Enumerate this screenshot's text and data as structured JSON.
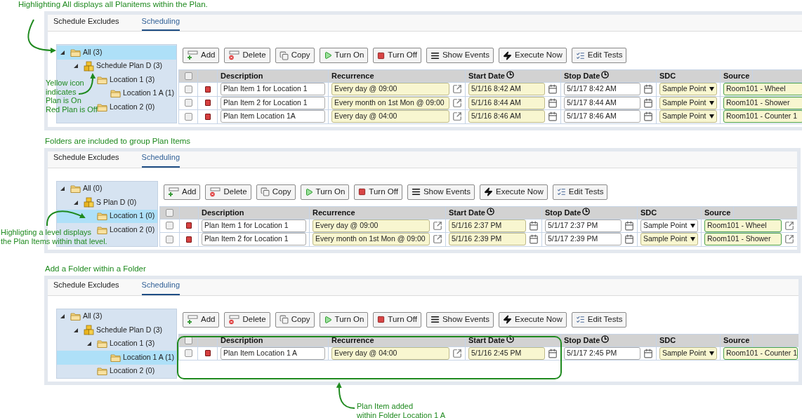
{
  "panels": [
    {
      "caption": "Highlighting All displays all Planitems within the Plan.",
      "tabs": [
        {
          "label": "Schedule Excludes",
          "selected": false
        },
        {
          "label": "Scheduling",
          "selected": true
        }
      ],
      "tree": [
        {
          "label": "All (3)",
          "kind": "folder",
          "expanded": true,
          "selected": true,
          "children": [
            {
              "label": "Schedule Plan D (3)",
              "kind": "plan",
              "expanded": true,
              "selected": false,
              "children": [
                {
                  "label": "Location 1 (3)",
                  "kind": "folder",
                  "expanded": false,
                  "selected": false,
                  "children": [
                    {
                      "label": "Location 1 A (1)",
                      "kind": "folder",
                      "expanded": false,
                      "selected": false
                    }
                  ]
                },
                {
                  "label": "Location 2 (0)",
                  "kind": "folder",
                  "expanded": false,
                  "selected": false
                }
              ]
            }
          ]
        }
      ],
      "toolbar": [
        {
          "label": "Add",
          "kind": "add"
        },
        {
          "label": "Delete",
          "kind": "delete"
        },
        {
          "label": "Copy",
          "kind": "copy"
        },
        {
          "label": "Turn On",
          "kind": "on"
        },
        {
          "label": "Turn Off",
          "kind": "off"
        },
        {
          "label": "Show Events",
          "kind": "events"
        },
        {
          "label": "Execute Now",
          "kind": "execute"
        },
        {
          "label": "Edit Tests",
          "kind": "tests"
        }
      ],
      "select_all_checked": false,
      "columns": [
        {
          "label": "Description",
          "clock": false
        },
        {
          "label": "Recurrence",
          "clock": false
        },
        {
          "label": "Start Date",
          "clock": true
        },
        {
          "label": "Stop Date",
          "clock": true
        },
        {
          "label": "SDC",
          "clock": false
        },
        {
          "label": "Source",
          "clock": false
        }
      ],
      "source_link": false,
      "rows": [
        {
          "checked": false,
          "on": false,
          "description": "Plan Item 1 for Location 1",
          "recurrence": "Every day @ 09:00",
          "start_date": "5/1/16 8:42 AM",
          "stop_date": "5/1/17 8:42 AM",
          "sdc": "Sample Point",
          "sdc_highlighted": true,
          "source": "Room101 - Wheel"
        },
        {
          "checked": false,
          "on": false,
          "description": "Plan Item 2 for Location 1",
          "recurrence": "Every month on 1st Mon @ 09:00",
          "start_date": "5/1/16 8:44 AM",
          "stop_date": "5/1/17 8:44 AM",
          "sdc": "Sample Point",
          "sdc_highlighted": true,
          "source": "Room101 - Shower"
        },
        {
          "checked": false,
          "on": false,
          "description": "Plan Item Location 1A",
          "recurrence": "Every day @ 04:00",
          "start_date": "5/1/16 8:46 AM",
          "stop_date": "5/1/17 8:46 AM",
          "sdc": "Sample Point",
          "sdc_highlighted": true,
          "source": "Room101 - Counter 1"
        }
      ],
      "outline": false,
      "note": {
        "lines": [
          "Yellow icon",
          "indicates",
          "Plan is On",
          "Red Plan is Off"
        ]
      }
    },
    {
      "caption": "Folders are included to group Plan Items",
      "tabs": [
        {
          "label": "Schedule Excludes",
          "selected": false
        },
        {
          "label": "Scheduling",
          "selected": true
        }
      ],
      "tree": [
        {
          "label": "All (0)",
          "kind": "folder",
          "expanded": true,
          "selected": false,
          "children": [
            {
              "label": "S Plan D (0)",
              "kind": "plan",
              "expanded": true,
              "selected": false,
              "children": [
                {
                  "label": "Location 1 (0)",
                  "kind": "folder",
                  "expanded": false,
                  "selected": true
                },
                {
                  "label": "Location 2 (0)",
                  "kind": "folder",
                  "expanded": false,
                  "selected": false
                }
              ]
            }
          ]
        }
      ],
      "toolbar": [
        {
          "label": "Add",
          "kind": "add"
        },
        {
          "label": "Delete",
          "kind": "delete"
        },
        {
          "label": "Copy",
          "kind": "copy"
        },
        {
          "label": "Turn On",
          "kind": "on"
        },
        {
          "label": "Turn Off",
          "kind": "off"
        },
        {
          "label": "Show Events",
          "kind": "events"
        },
        {
          "label": "Execute Now",
          "kind": "execute"
        },
        {
          "label": "Edit Tests",
          "kind": "tests"
        }
      ],
      "select_all_checked": false,
      "columns": [
        {
          "label": "Description",
          "clock": false
        },
        {
          "label": "Recurrence",
          "clock": false
        },
        {
          "label": "Start Date",
          "clock": true
        },
        {
          "label": "Stop Date",
          "clock": true
        },
        {
          "label": "SDC",
          "clock": false
        },
        {
          "label": "Source",
          "clock": false
        }
      ],
      "source_link": true,
      "rows": [
        {
          "checked": false,
          "on": false,
          "description": "Plan Item 1 for Location 1",
          "recurrence": "Every day @ 09:00",
          "start_date": "5/1/16 2:37 PM",
          "stop_date": "5/1/17 2:37 PM",
          "sdc": "Sample Point",
          "sdc_highlighted": false,
          "source": "Room101 - Wheel"
        },
        {
          "checked": false,
          "on": false,
          "description": "Plan Item 2 for Location 1",
          "recurrence": "Every month on 1st Mon @ 09:00",
          "start_date": "5/1/16 2:39 PM",
          "stop_date": "5/1/17 2:39 PM",
          "sdc": "Sample Point",
          "sdc_highlighted": true,
          "source": "Room101 - Shower"
        }
      ],
      "outline": false,
      "note": {
        "lines": [
          "Highligting a level displays",
          "the Plan Items within that level."
        ]
      }
    },
    {
      "caption": "Add a Folder within a Folder",
      "tabs": [
        {
          "label": "Schedule Excludes",
          "selected": false
        },
        {
          "label": "Scheduling",
          "selected": true
        }
      ],
      "tree": [
        {
          "label": "All (3)",
          "kind": "folder",
          "expanded": true,
          "selected": false,
          "children": [
            {
              "label": "Schedule Plan D (3)",
              "kind": "plan",
              "expanded": true,
              "selected": false,
              "children": [
                {
                  "label": "Location 1 (3)",
                  "kind": "folder",
                  "expanded": true,
                  "selected": false,
                  "children": [
                    {
                      "label": "Location 1 A (1)",
                      "kind": "folder",
                      "expanded": false,
                      "selected": true
                    }
                  ]
                },
                {
                  "label": "Location 2 (0)",
                  "kind": "folder",
                  "expanded": false,
                  "selected": false
                }
              ]
            }
          ]
        }
      ],
      "toolbar": [
        {
          "label": "Add",
          "kind": "add"
        },
        {
          "label": "Delete",
          "kind": "delete"
        },
        {
          "label": "Copy",
          "kind": "copy"
        },
        {
          "label": "Turn On",
          "kind": "on"
        },
        {
          "label": "Turn Off",
          "kind": "off"
        },
        {
          "label": "Show Events",
          "kind": "events"
        },
        {
          "label": "Execute Now",
          "kind": "execute"
        },
        {
          "label": "Edit Tests",
          "kind": "tests"
        }
      ],
      "select_all_checked": false,
      "columns": [
        {
          "label": "Description",
          "clock": false
        },
        {
          "label": "Recurrence",
          "clock": false
        },
        {
          "label": "Start Date",
          "clock": true
        },
        {
          "label": "Stop Date",
          "clock": true
        },
        {
          "label": "SDC",
          "clock": false
        },
        {
          "label": "Source",
          "clock": false
        }
      ],
      "source_link": false,
      "rows": [
        {
          "checked": false,
          "on": false,
          "description": "Plan Item Location 1 A",
          "recurrence": "Every day @ 04:00",
          "start_date": "5/1/16 2:45 PM",
          "stop_date": "5/1/17 2:45 PM",
          "sdc": "Sample Point",
          "sdc_highlighted": true,
          "source": "Room101 - Counter 1"
        }
      ],
      "outline": true,
      "note": {
        "lines": [
          "Plan Item added",
          "within Folder Location 1 A"
        ]
      }
    }
  ]
}
